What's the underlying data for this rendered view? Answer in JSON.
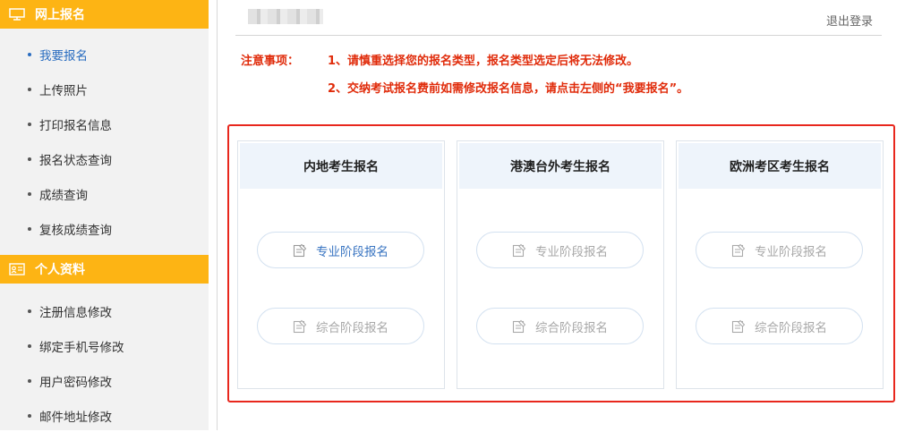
{
  "sidebar": {
    "section1": {
      "title": "网上报名",
      "icon": "monitor-icon"
    },
    "section1_items": [
      {
        "label": "我要报名",
        "active": true
      },
      {
        "label": "上传照片",
        "active": false
      },
      {
        "label": "打印报名信息",
        "active": false
      },
      {
        "label": "报名状态查询",
        "active": false
      },
      {
        "label": "成绩查询",
        "active": false
      },
      {
        "label": "复核成绩查询",
        "active": false
      }
    ],
    "section2": {
      "title": "个人资料",
      "icon": "id-card-icon"
    },
    "section2_items": [
      {
        "label": "注册信息修改"
      },
      {
        "label": "绑定手机号修改"
      },
      {
        "label": "用户密码修改"
      },
      {
        "label": "邮件地址修改"
      }
    ]
  },
  "header": {
    "logout": "退出登录"
  },
  "notice": {
    "label": "注意事项：",
    "line1": "1、请慎重选择您的报名类型，报名类型选定后将无法修改。",
    "line2": "2、交纳考试报名费前如需修改报名信息，请点击左侧的“我要报名”。"
  },
  "cards": [
    {
      "title": "内地考生报名",
      "buttons": [
        {
          "label": "专业阶段报名",
          "enabled": true
        },
        {
          "label": "综合阶段报名",
          "enabled": false
        }
      ]
    },
    {
      "title": "港澳台外考生报名",
      "buttons": [
        {
          "label": "专业阶段报名",
          "enabled": false
        },
        {
          "label": "综合阶段报名",
          "enabled": false
        }
      ]
    },
    {
      "title": "欧洲考区考生报名",
      "buttons": [
        {
          "label": "专业阶段报名",
          "enabled": false
        },
        {
          "label": "综合阶段报名",
          "enabled": false
        }
      ]
    }
  ],
  "colors": {
    "accent": "#fdb414",
    "notice": "#e02b0a",
    "link": "#2a6dc0",
    "highlight": "#e8271d"
  }
}
